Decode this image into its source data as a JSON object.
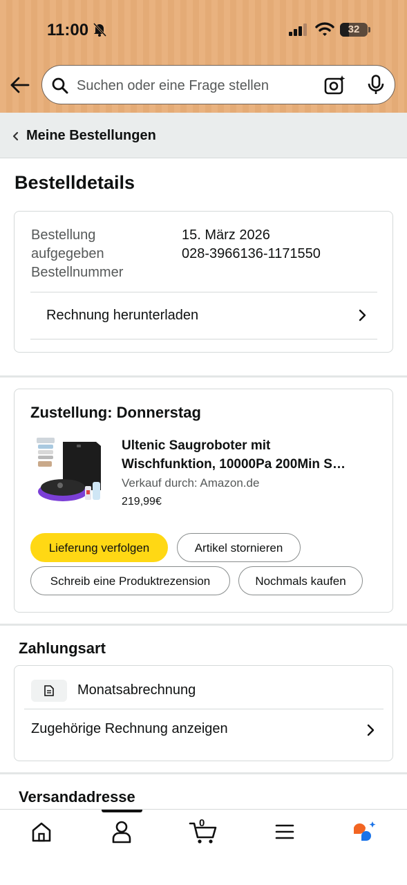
{
  "status_bar": {
    "time": "11:00",
    "battery_level": "32"
  },
  "search": {
    "placeholder": "Suchen oder eine Frage stellen"
  },
  "breadcrumb": {
    "label": "Meine Bestellungen"
  },
  "page": {
    "title": "Bestelldetails"
  },
  "order_info": {
    "placed_label": "Bestellung aufgegeben",
    "number_label": "Bestellnummer",
    "placed_value": "15. März 2026",
    "number_value": "028-3966136-1171550",
    "invoice_link": "Rechnung herunterladen"
  },
  "shipment": {
    "title": "Zustellung: Donnerstag",
    "product": {
      "name_line1": "Ultenic Saugroboter mit",
      "name_line2": "Wischfunktion, 10000Pa 200Min S…",
      "seller": "Verkauf durch: Amazon.de",
      "price": "219,99€"
    },
    "buttons": {
      "track": "Lieferung verfolgen",
      "cancel": "Artikel stornieren",
      "review": "Schreib eine Produktrezension",
      "buy_again": "Nochmals kaufen"
    }
  },
  "payment": {
    "title": "Zahlungsart",
    "method": "Monatsabrechnung",
    "invoice_link": "Zugehörige Rechnung anzeigen"
  },
  "shipping_address": {
    "title": "Versandadresse"
  },
  "bottom_nav": {
    "cart_count": "0",
    "items": [
      "home-icon",
      "account-icon",
      "cart-icon",
      "menu-icon",
      "rufus-assistant-icon"
    ]
  },
  "colors": {
    "header": "#e9b27f",
    "primary_button": "#ffd814",
    "breadcrumb_bg": "#eaeded"
  }
}
